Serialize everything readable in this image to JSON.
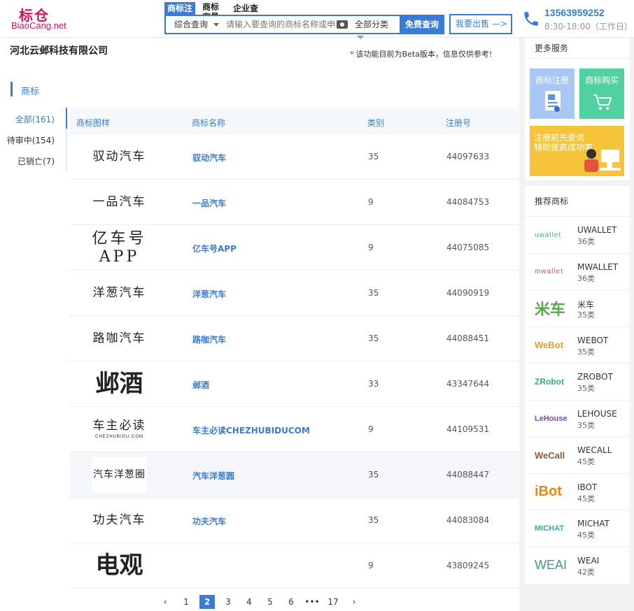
{
  "header": {
    "logo_cn": "标仓",
    "logo_en": "BiaoCang.net",
    "tabs": [
      "商标注",
      "商标交易",
      "企业查"
    ],
    "scope": "综合查询",
    "search_placeholder": "请输入要查询的商标名称或申",
    "category": "全部分类",
    "submit": "免费查询",
    "sell": "我要出售 —>",
    "phone": "13563959252",
    "hours": "8:30-18:00（工作日）"
  },
  "company": "河北云邺科技有限公司",
  "beta_note": "该功能目前为Beta版本，信息仅供参考!",
  "section": "商标",
  "filters": [
    "全部(161)",
    "待审中(154)",
    "已销亡(7)"
  ],
  "table": {
    "headers": [
      "商标图样",
      "商标名称",
      "类别",
      "注册号"
    ],
    "rows": [
      {
        "img": "驭动汽车",
        "name": "驭动汽车",
        "cls": "35",
        "reg": "44097633"
      },
      {
        "img": "一品汽车",
        "name": "一品汽车",
        "cls": "9",
        "reg": "44084753"
      },
      {
        "img": "亿车号APP",
        "name": "亿车号APP",
        "cls": "9",
        "reg": "44075085"
      },
      {
        "img": "洋葱汽车",
        "name": "洋葱汽车",
        "cls": "35",
        "reg": "44090919"
      },
      {
        "img": "路咖汽车",
        "name": "路咖汽车",
        "cls": "35",
        "reg": "44088451"
      },
      {
        "img": "邺酒",
        "name": "邺酒",
        "cls": "33",
        "reg": "43347644"
      },
      {
        "img": "车主必读",
        "img_sub": "CHEZHUBIDU.COM",
        "name": "车主必读CHEZHUBIDUCOM",
        "cls": "9",
        "reg": "44109531"
      },
      {
        "img": "汽车洋葱圈",
        "name": "汽车洋葱圆",
        "cls": "35",
        "reg": "44088447"
      },
      {
        "img": "功夫汽车",
        "name": "功夫汽车",
        "cls": "35",
        "reg": "44083084"
      },
      {
        "img": "电观",
        "name": "",
        "cls": "9",
        "reg": "43809245"
      }
    ]
  },
  "pager": [
    "‹",
    "1",
    "2",
    "3",
    "4",
    "5",
    "6",
    "•••",
    "17",
    "›"
  ],
  "pager_current": "2",
  "sidebar": {
    "services_title": "更多服务",
    "service_register": "商标注册",
    "service_buy": "商标购买",
    "promo": "注册前先查询\n辅助提高成功率",
    "rec_title": "推荐商标",
    "recs": [
      {
        "logo": "uwallet",
        "name": "UWALLET",
        "cls": "36类",
        "color": "#4aa88a"
      },
      {
        "logo": "mwallet",
        "name": "MWALLET",
        "cls": "36类",
        "color": "#c0507a"
      },
      {
        "logo": "米车",
        "name": "米车",
        "cls": "35类",
        "color": "#5aa84a"
      },
      {
        "logo": "WeBot",
        "name": "WEBOT",
        "cls": "35类",
        "color": "#e0a020"
      },
      {
        "logo": "ZRobot",
        "name": "ZROBOT",
        "cls": "35类",
        "color": "#3aa88a"
      },
      {
        "logo": "LeHouse",
        "name": "LEHOUSE",
        "cls": "35类",
        "color": "#7a4aa0"
      },
      {
        "logo": "WeCall",
        "name": "WECALL",
        "cls": "45类",
        "color": "#8a5a3a"
      },
      {
        "logo": "iBot",
        "name": "IBOT",
        "cls": "45类",
        "color": "#e08a10"
      },
      {
        "logo": "MICHAT",
        "name": "MICHAT",
        "cls": "45类",
        "color": "#3aa8a0"
      },
      {
        "logo": "WEAI",
        "name": "WEAI",
        "cls": "42类",
        "color": "#3a9a90"
      }
    ]
  }
}
